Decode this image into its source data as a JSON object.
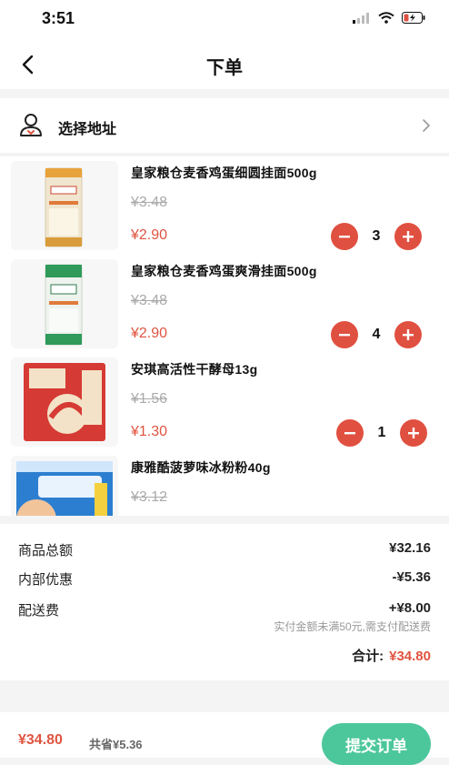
{
  "status_bar": {
    "time": "3:51"
  },
  "nav": {
    "title": "下单"
  },
  "address": {
    "label": "选择地址"
  },
  "products": [
    {
      "name": "皇家粮仓麦香鸡蛋细圆挂面500g",
      "original_price": "¥3.48",
      "price": "¥2.90",
      "quantity": "3"
    },
    {
      "name": "皇家粮仓麦香鸡蛋爽滑挂面500g",
      "original_price": "¥3.48",
      "price": "¥2.90",
      "quantity": "4"
    },
    {
      "name": "安琪高活性干酵母13g",
      "original_price": "¥1.56",
      "price": "¥1.30",
      "quantity": "1"
    },
    {
      "name": "康雅酷菠萝味冰粉粉40g",
      "original_price": "¥3.12",
      "price": "",
      "quantity": ""
    }
  ],
  "summary": {
    "goods_total_label": "商品总额",
    "goods_total_value": "¥32.16",
    "discount_label": "内部优惠",
    "discount_value": "-¥5.36",
    "delivery_label": "配送费",
    "delivery_value": "+¥8.00",
    "delivery_note": "实付金额未满50元,需支付配送费",
    "total_label": "合计:",
    "total_value": "¥34.80"
  },
  "bottom_bar": {
    "price": "¥34.80",
    "saved": "共省¥5.36",
    "submit_label": "提交订单"
  },
  "colors": {
    "accent_red": "#e05440",
    "submit_green": "#4cc79b"
  }
}
